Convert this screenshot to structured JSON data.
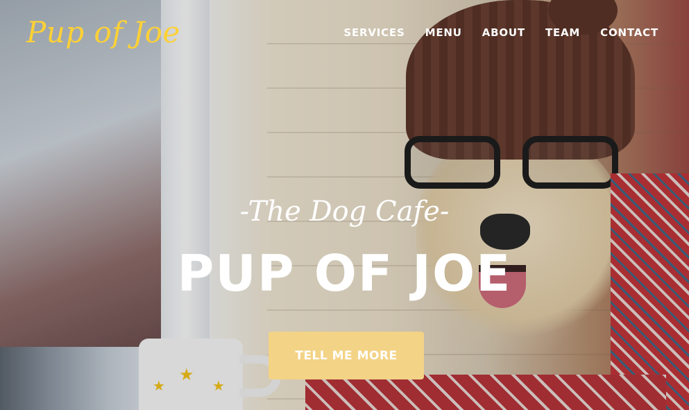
{
  "brand": {
    "logo_text": "Pup of Joe"
  },
  "nav": {
    "items": [
      {
        "label": "SERVICES"
      },
      {
        "label": "MENU"
      },
      {
        "label": "ABOUT"
      },
      {
        "label": "TEAM"
      },
      {
        "label": "CONTACT"
      }
    ]
  },
  "hero": {
    "subheading": "-The Dog Cafe-",
    "heading": "PUP OF JOE",
    "cta_label": "TELL ME MORE",
    "background_image": "dog-in-knit-hat-with-glasses"
  },
  "colors": {
    "accent": "#fed136",
    "button": "#f3d386",
    "text": "#ffffff"
  }
}
